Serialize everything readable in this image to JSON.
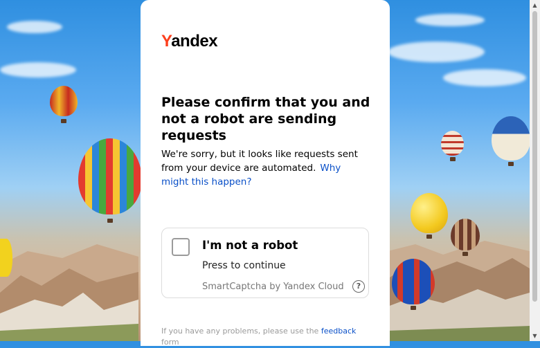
{
  "logo": {
    "first_letter": "Y",
    "rest": "andex"
  },
  "heading": "Please confirm that you and not a robot are sending requests",
  "description": {
    "text": "We're sorry, but it looks like requests sent from your device are automated.",
    "link": "Why might this happen?"
  },
  "captcha": {
    "title": "I'm not a robot",
    "subtitle": "Press to continue",
    "brand": "SmartCaptcha by Yandex Cloud",
    "help_glyph": "?",
    "checked": false
  },
  "footer": {
    "text": "If you have any problems, please use the",
    "link": "feedback",
    "tail": "form"
  },
  "colors": {
    "accent_link": "#0a50c8",
    "logo_y": "#fc3f1d"
  }
}
